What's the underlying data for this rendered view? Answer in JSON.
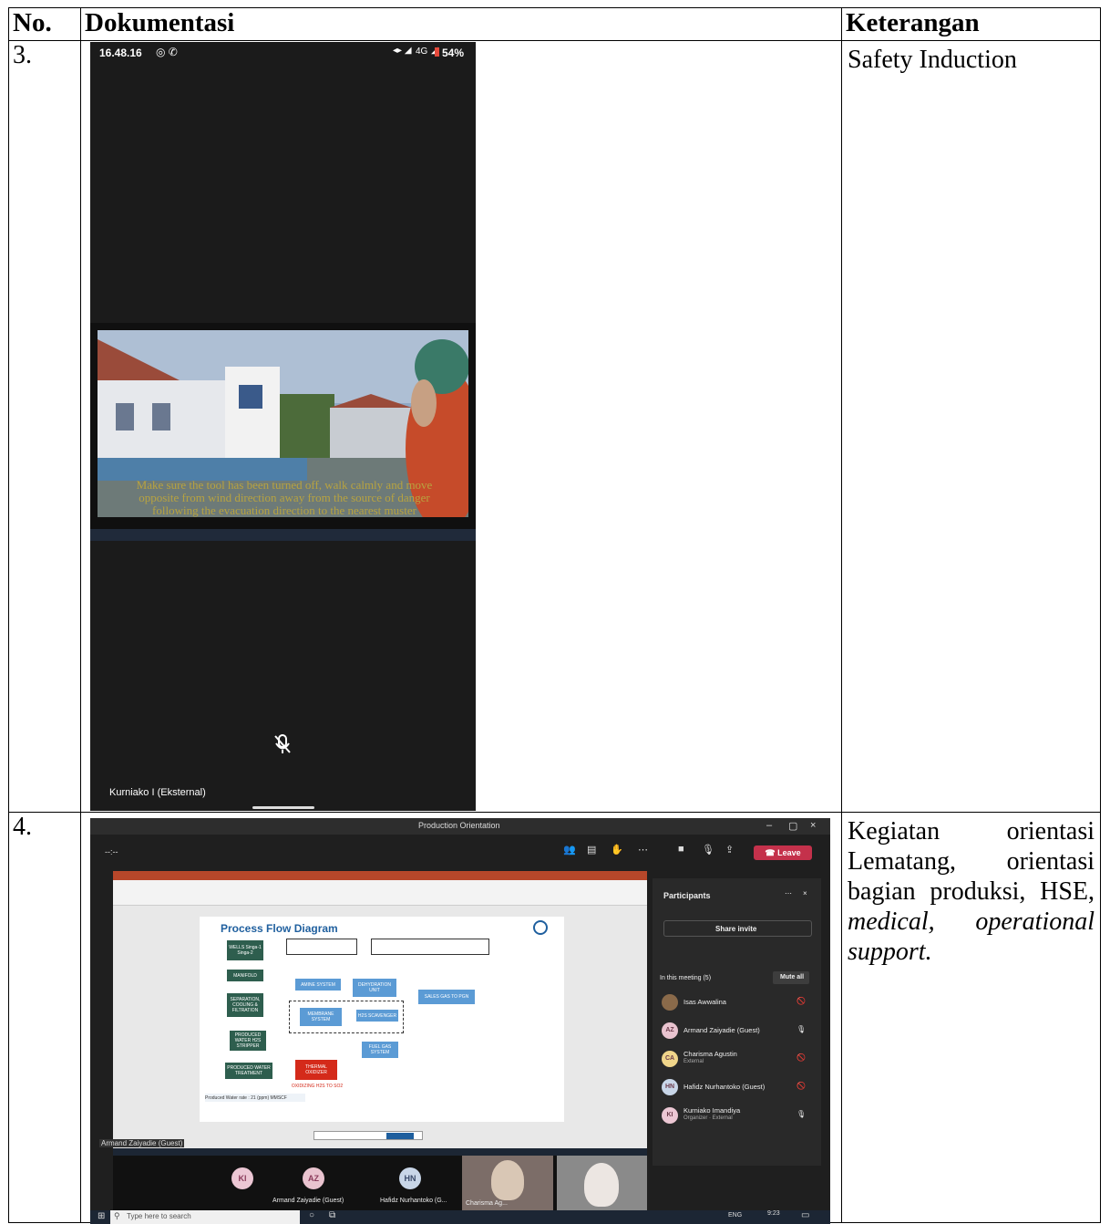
{
  "table": {
    "headers": {
      "no": "No.",
      "doc": "Dokumentasi",
      "ket": "Keterangan"
    },
    "rows": [
      {
        "no": "3.",
        "keterangan": "Safety Induction"
      },
      {
        "no": "4.",
        "keterangan_parts": {
          "p1": "Kegiatan orientasi Lematang, orientasi bagian produksi, HSE, ",
          "p2": "medical, operational support."
        }
      }
    ]
  },
  "phone_screenshot": {
    "time": "16.48.16",
    "status_right": "4G",
    "battery": "54%",
    "subtitle": "Make sure the tool has been turned off, walk calmly and move opposite from wind direction away from the source of danger following the evacuation direction to the nearest muster point/assembly area",
    "tile_name": "Kurniako I (Eksternal)",
    "colors": {
      "background": "#1b1b1b"
    }
  },
  "teams_screenshot": {
    "window_title": "Production Orientation",
    "timer": "--:--",
    "leave_label": "Leave",
    "participants_title": "Participants",
    "share_invite": "Share invite",
    "in_meeting": "In this meeting (5)",
    "mute_all": "Mute all",
    "participants": [
      {
        "initials": "",
        "name": "Isas Awwalina",
        "sub": "",
        "color": "#8a6a4a"
      },
      {
        "initials": "AZ",
        "name": "Armand Zaiyadie (Guest)",
        "sub": "",
        "color": "#e9c3cf"
      },
      {
        "initials": "CA",
        "name": "Charisma Agustin",
        "sub": "External",
        "color": "#f0d58a"
      },
      {
        "initials": "HN",
        "name": "Hafidz Nurhantoko (Guest)",
        "sub": "",
        "color": "#c8d6e8"
      },
      {
        "initials": "KI",
        "name": "Kurniako Imandiya",
        "sub": "Organizer · External",
        "color": "#ecc7d4"
      }
    ],
    "slide_title": "Process Flow Diagram",
    "slide_boxes": {
      "wells": "WELLS Singa-1 Singa-2",
      "manifold": "MANIFOLD",
      "separation": "SEPARATION, COOLING & FILTRATION",
      "produced_water_stripper": "PRODUCED WATER H2S STRIPPER",
      "produced_water_treatment": "PRODUCED WATER TREATMENT",
      "amine": "AMINE SYSTEM",
      "dehydration": "DEHYDRATION UNIT",
      "membrane": "MEMBRANE SYSTEM",
      "h2s_scavenger": "H2S SCAVENGER",
      "sales_gas": "SALES GAS TO PGN",
      "fuel_gas": "FUEL GAS SYSTEM",
      "thermal_oxidizer": "THERMAL OXIDIZER",
      "oxidizing": "OXIDIZING H2S TO SO2",
      "produced_water_rate": "Produced Water rate : 21 (ppm) MMSCF"
    },
    "presenter_label": "Armand Zaiyadie (Guest)",
    "tiles": [
      {
        "initials": "KI",
        "name": ""
      },
      {
        "initials": "AZ",
        "name": "Armand Zaiyadie (Guest)"
      },
      {
        "initials": "HN",
        "name": "Hafidz Nurhantoko (G..."
      },
      {
        "initials": "",
        "name": "Charisma Ag..."
      }
    ],
    "search_placeholder": "Type here to search",
    "tray_lang": "ENG",
    "tray_time": "9:23",
    "colors": {
      "leave": "#c4314b",
      "slide_title": "#1f5f9e",
      "box_blue": "#5b9bd5",
      "box_green": "#2e5e4e",
      "box_red": "#d42a1a"
    }
  }
}
